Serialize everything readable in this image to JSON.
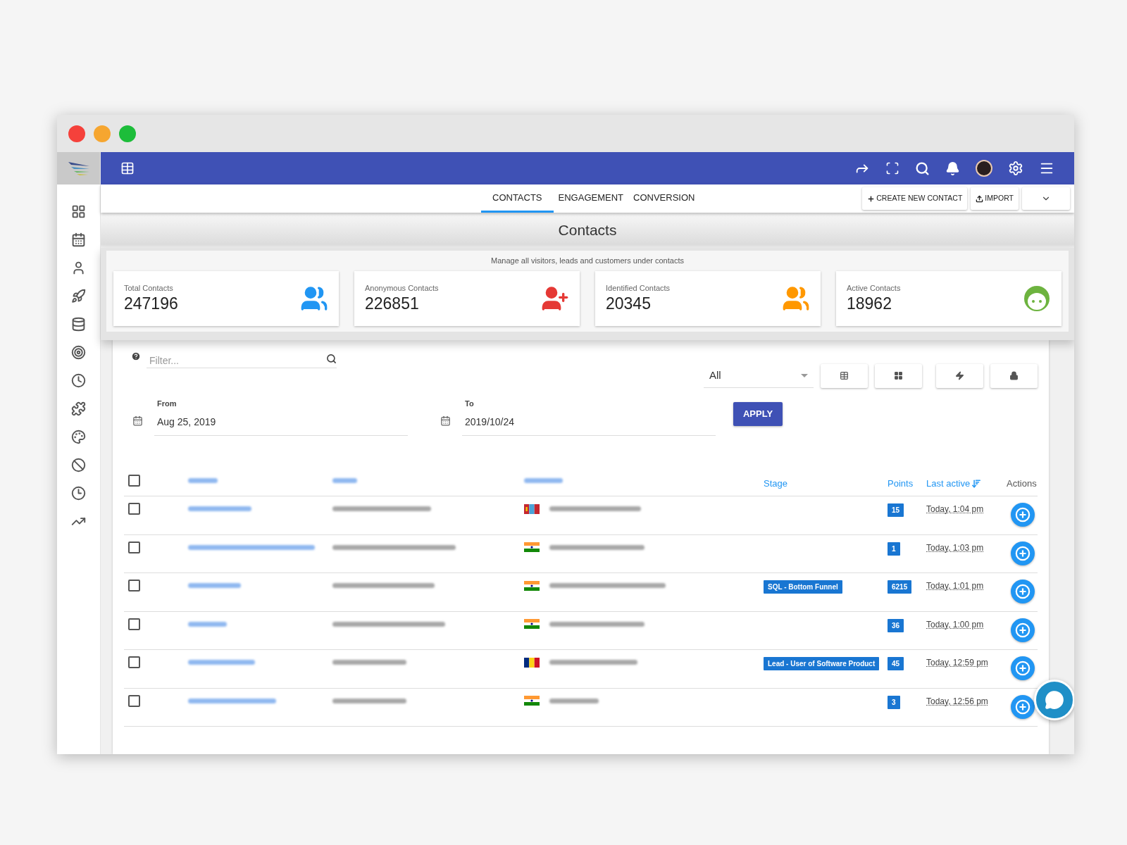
{
  "window": {
    "controls": [
      {
        "color": "#f5413b"
      },
      {
        "color": "#f6a630"
      },
      {
        "color": "#1dbd3a"
      }
    ]
  },
  "tabs": [
    {
      "label": "CONTACTS",
      "selected": true
    },
    {
      "label": "ENGAGEMENT",
      "selected": false
    },
    {
      "label": "CONVERSION",
      "selected": false
    }
  ],
  "actions": [
    {
      "label": "CREATE NEW CONTACT",
      "kind": "plus"
    },
    {
      "label": "IMPORT",
      "kind": "upload"
    },
    {
      "kind": "menu"
    }
  ],
  "page": {
    "title": "Contacts",
    "subtitle": "Manage all visitors, leads and customers under contacts"
  },
  "stats": [
    {
      "label": "Total Contacts",
      "value": "247196",
      "kind": "people",
      "color": "#2196f3"
    },
    {
      "label": "Anonymous Contacts",
      "value": "226851",
      "kind": "add-person",
      "color": "#e53935"
    },
    {
      "label": "Identified Contacts",
      "value": "20345",
      "kind": "people",
      "color": "#ff9800"
    },
    {
      "label": "Active Contacts",
      "value": "18962",
      "kind": "face",
      "color": "#6db33f"
    }
  ],
  "filter": {
    "placeholder": "Filter...",
    "segment": "All"
  },
  "dates": [
    {
      "label": "From",
      "value": "Aug 25, 2019"
    },
    {
      "label": "To",
      "value": "2019/10/24"
    }
  ],
  "apply": "APPLY",
  "table": {
    "header_checked": false,
    "columns": [
      "Stage",
      "Points",
      "Last active",
      "Actions"
    ],
    "rows": [
      {
        "checked": false,
        "flag": {
          "kind": "mn"
        },
        "stage": null,
        "points": "15",
        "last_active": "Today, 1:04 pm"
      },
      {
        "checked": false,
        "flag": {
          "kind": "in"
        },
        "stage": null,
        "points": "1",
        "last_active": "Today, 1:03 pm"
      },
      {
        "checked": false,
        "flag": {
          "kind": "in"
        },
        "stage": "SQL - Bottom Funnel",
        "points": "6215",
        "last_active": "Today, 1:01 pm"
      },
      {
        "checked": false,
        "flag": {
          "kind": "in"
        },
        "stage": null,
        "points": "36",
        "last_active": "Today, 1:00 pm"
      },
      {
        "checked": false,
        "flag": {
          "kind": "ro"
        },
        "stage": "Lead - User of Software Product",
        "points": "45",
        "last_active": "Today, 12:59 pm"
      },
      {
        "checked": false,
        "flag": {
          "kind": "in"
        },
        "stage": null,
        "points": "3",
        "last_active": "Today, 12:56 pm"
      }
    ]
  }
}
